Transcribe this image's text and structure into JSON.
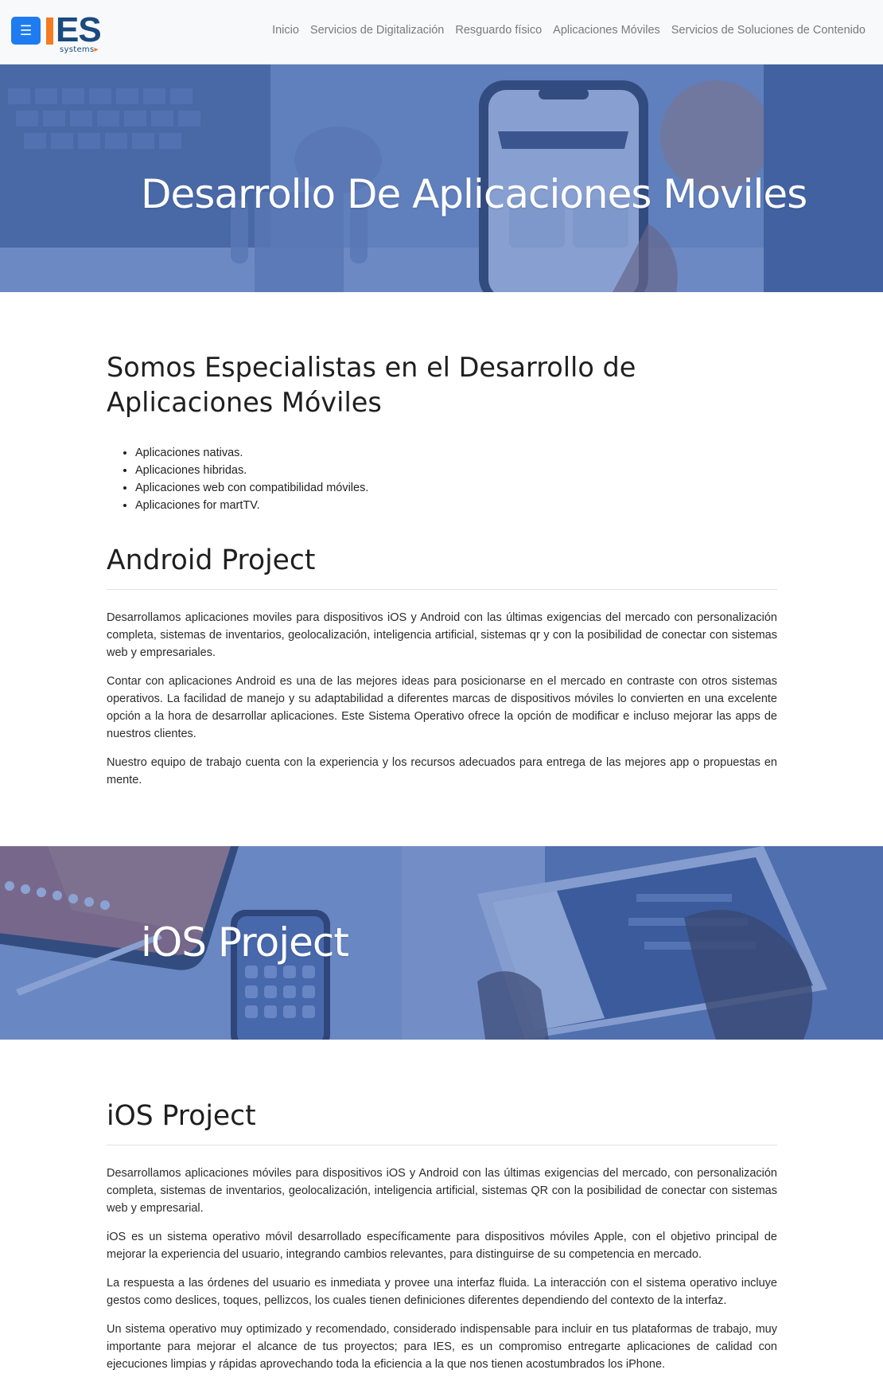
{
  "nav": {
    "menu_icon": "hamburger-icon",
    "menu_glyph": "☰",
    "logo_letters": "ES",
    "logo_sub": "systems",
    "links": [
      "Inicio",
      "Servicios de Digitalización",
      "Resguardo físico",
      "Aplicaciones Móviles",
      "Servicios de Soluciones de Contenido"
    ]
  },
  "hero_main": {
    "title": "Desarrollo De Aplicaciones Moviles"
  },
  "intro": {
    "heading_line1": "Somos Especialistas en el Desarrollo de",
    "heading_line2": "Aplicaciones Móviles",
    "features": [
      "Aplicaciones nativas.",
      "Aplicaciones hibridas.",
      "Aplicaciones web con compatibilidad móviles.",
      "Aplicaciones for martTV."
    ]
  },
  "android": {
    "heading": "Android Project",
    "paragraphs": [
      "Desarrollamos aplicaciones moviles para dispositivos iOS y Android con las últimas exigencias del mercado con personalización completa, sistemas de inventarios, geolocalización, inteligencia artificial, sistemas qr y con la posibilidad de conectar con sistemas web y empresariales.",
      "Contar con aplicaciones Android es una de las mejores ideas para posicionarse en el mercado en contraste con otros sistemas operativos. La facilidad de manejo y su adaptabilidad a diferentes marcas de dispositivos móviles lo convierten en una excelente opción a la hora de desarrollar aplicaciones. Este Sistema Operativo ofrece la opción de modificar e incluso mejorar las apps de nuestros clientes.",
      "Nuestro equipo de trabajo cuenta con la experiencia y los recursos adecuados para entrega de las mejores app o propuestas en mente."
    ]
  },
  "hero_ios": {
    "title": "iOS Project"
  },
  "ios": {
    "heading": "iOS Project",
    "paragraphs": [
      "Desarrollamos aplicaciones móviles para dispositivos iOS y Android con las últimas exigencias del mercado, con personalización completa, sistemas de inventarios, geolocalización, inteligencia artificial, sistemas QR con la posibilidad de conectar con sistemas web y empresarial.",
      "iOS es un sistema operativo móvil desarrollado específicamente para dispositivos móviles Apple, con el objetivo principal de mejorar la experiencia del usuario, integrando cambios relevantes, para distinguirse de su competencia en mercado.",
      "La respuesta a las órdenes del usuario es inmediata y provee una interfaz fluida. La interacción con el sistema operativo incluye gestos como deslices, toques, pellizcos, los cuales tienen definiciones diferentes dependiendo del contexto de la interfaz.",
      "Un sistema operativo muy optimizado y recomendado, considerado indispensable para incluir en tus plataformas de trabajo, muy importante para mejorar el alcance de tus proyectos; para IES, es un compromiso entregarte aplicaciones de calidad con ejecuciones limpias y rápidas aprovechando toda la eficiencia a la que nos tienen acostumbrados los iPhone."
    ]
  },
  "colors": {
    "accent": "#1e7cf0",
    "logo_blue": "#1a4a7e",
    "logo_orange": "#f47b20",
    "hero_overlay": "#3a62b4"
  }
}
